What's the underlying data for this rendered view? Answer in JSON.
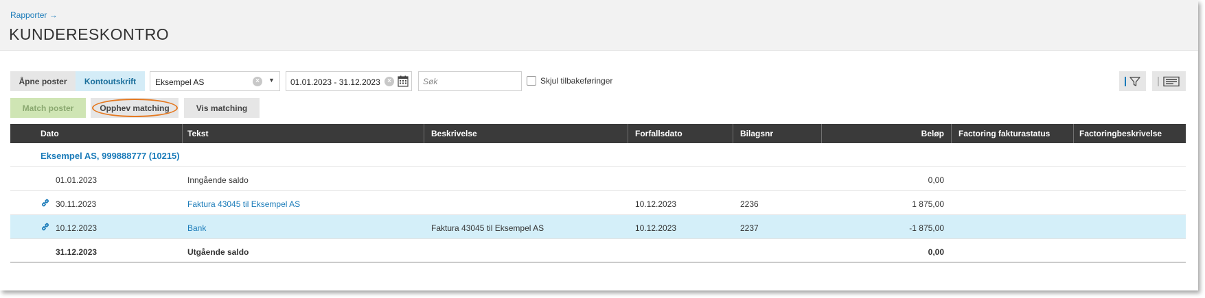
{
  "header": {
    "breadcrumb": "Rapporter →",
    "title": "KUNDERESKONTRO"
  },
  "toolbar": {
    "tab_open_items": "Åpne poster",
    "tab_statement": "Kontoutskrift",
    "customer_value": "Eksempel AS",
    "date_range_value": "01.01.2023 - 31.12.2023",
    "search_placeholder": "Søk",
    "hide_reversals_label": "Skjul tilbakeføringer"
  },
  "actions": {
    "match_label": "Match poster",
    "unmatch_label": "Opphev matching",
    "show_matching_label": "Vis matching"
  },
  "table": {
    "columns": [
      "Dato",
      "Tekst",
      "Beskrivelse",
      "Forfallsdato",
      "Bilagsnr",
      "Beløp",
      "Factoring fakturastatus",
      "Factoringbeskrivelse"
    ],
    "group_title": "Eksempel AS, 999888777 (10215)",
    "rows": [
      {
        "date": "01.01.2023",
        "text": "Inngående saldo",
        "description": "",
        "due_date": "",
        "voucher": "",
        "amount": "0,00",
        "linked": false,
        "text_is_link": false
      },
      {
        "date": "30.11.2023",
        "text": "Faktura 43045 til Eksempel AS",
        "description": "",
        "due_date": "10.12.2023",
        "voucher": "2236",
        "amount": "1 875,00",
        "linked": true,
        "text_is_link": true
      },
      {
        "date": "10.12.2023",
        "text": "Bank",
        "description": "Faktura 43045 til Eksempel AS",
        "due_date": "10.12.2023",
        "voucher": "2237",
        "amount": "-1 875,00",
        "linked": true,
        "text_is_link": true
      },
      {
        "date": "31.12.2023",
        "text": "Utgående saldo",
        "description": "",
        "due_date": "",
        "voucher": "",
        "amount": "0,00",
        "linked": false,
        "text_is_link": false
      }
    ]
  },
  "colors": {
    "accent": "#1a7bb9",
    "selected_row": "#d4eff9",
    "match_button": "#cfe5b4",
    "header_bar": "#3a3a3a",
    "highlight_oval": "#e57a22"
  },
  "icons": {
    "clear": "clear-icon",
    "dropdown": "chevron-down-icon",
    "calendar": "calendar-icon",
    "filter": "filter-icon",
    "columns": "columns-icon",
    "link": "link-icon"
  }
}
